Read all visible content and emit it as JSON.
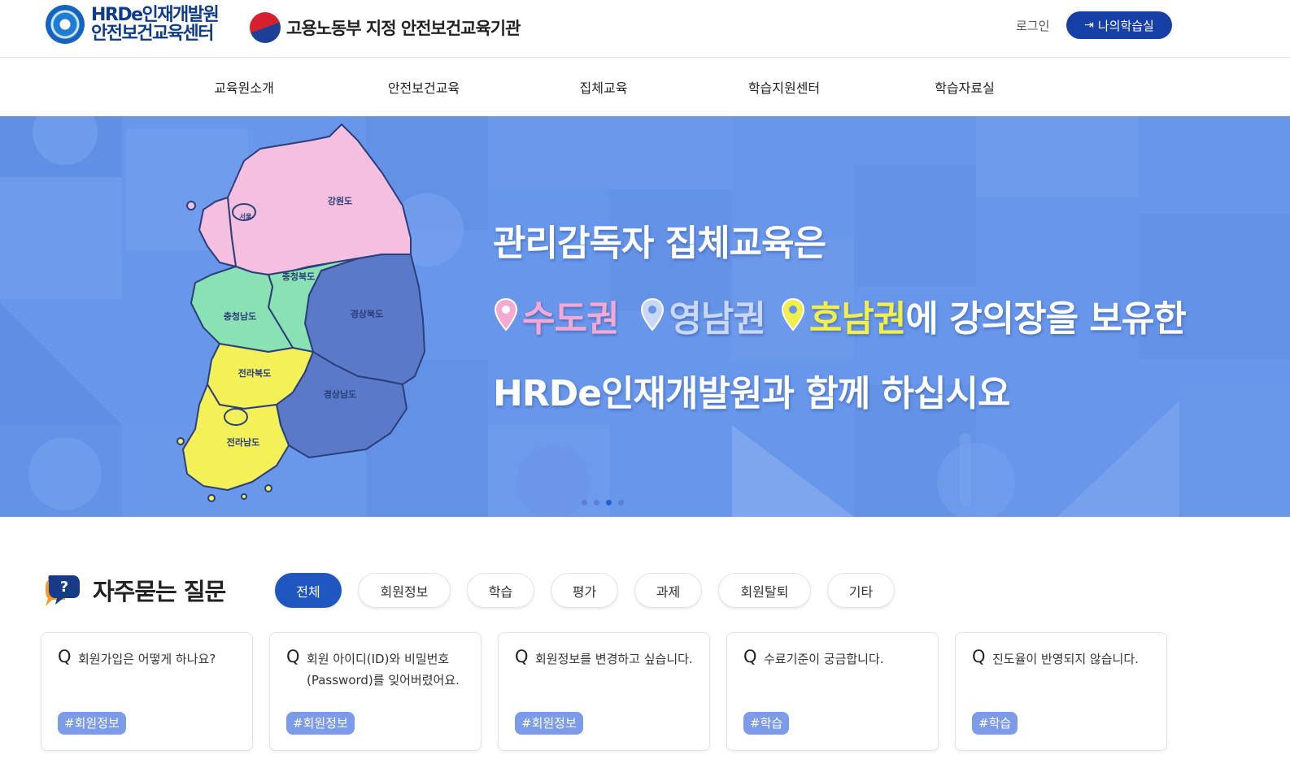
{
  "header": {
    "logo_line1": "HRDe인재개발원",
    "logo_line2": "안전보건교육센터",
    "ministry_label": "고용노동부 지정 안전보건교육기관",
    "login_label": "로그인",
    "my_learning_label": "나의학습실"
  },
  "nav": {
    "items": [
      "교육원소개",
      "안전보건교육",
      "집체교육",
      "학습지원센터",
      "학습자료실"
    ]
  },
  "hero": {
    "line1": "관리감독자 집체교육은",
    "region1": "수도권",
    "region2": "영남권",
    "region3": "호남권",
    "line2_suffix": "에 강의장을 보유한",
    "line3": "HRDe인재개발원과 함께 하십시요",
    "map_labels": {
      "gangwon": "강원도",
      "seoul": "서울",
      "chungbuk": "충청북도",
      "chungnam": "충청남도",
      "gyeongbuk": "경상북도",
      "jeonbuk": "전라북도",
      "jeonnam": "전라남도",
      "gyeongnam": "경상남도"
    },
    "slide_count": 4,
    "active_slide": 3,
    "colors": {
      "pink": "#f5a8d2",
      "blue": "#c9d8f6",
      "yellow": "#f1ef4a"
    }
  },
  "faq": {
    "title": "자주묻는 질문",
    "filters": [
      "전체",
      "회원정보",
      "학습",
      "평가",
      "과제",
      "회원탈퇴",
      "기타"
    ],
    "active_filter": "전체",
    "q_mark": "Q",
    "cards": [
      {
        "question": "회원가입은 어떻게 하나요?",
        "tag": "#회원정보"
      },
      {
        "question": "회원 아이디(ID)와 비밀번호(Password)를 잊어버렸어요.",
        "tag": "#회원정보"
      },
      {
        "question": "회원정보를 변경하고 싶습니다.",
        "tag": "#회원정보"
      },
      {
        "question": "수료기준이 궁금합니다.",
        "tag": "#학습"
      },
      {
        "question": "진도율이 반영되지 않습니다.",
        "tag": "#학습"
      }
    ]
  }
}
